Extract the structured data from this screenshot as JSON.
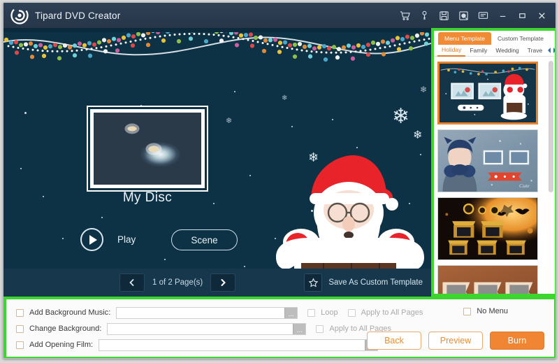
{
  "window": {
    "app_title": "Tipard DVD Creator",
    "logo_icon": "swirl-logo-icon",
    "titlebar_icons": [
      {
        "name": "cart-icon",
        "label": "Buy"
      },
      {
        "name": "key-icon",
        "label": "Register"
      },
      {
        "name": "save-icon",
        "label": "Save"
      },
      {
        "name": "help-icon",
        "label": "Help"
      },
      {
        "name": "feedback-icon",
        "label": "Feedback"
      },
      {
        "name": "minimize-icon",
        "label": "Minimize"
      },
      {
        "name": "maximize-icon",
        "label": "Maximize"
      },
      {
        "name": "close-icon",
        "label": "Close"
      }
    ]
  },
  "preview": {
    "disc_title": "My Disc",
    "play_label": "Play",
    "scene_label": "Scene",
    "page_count": "1 of 2 Page(s)",
    "prev_icon": "chevron-left-icon",
    "next_icon": "chevron-right-icon",
    "save_template_label": "Save As Custom Template",
    "save_template_icon": "star-icon",
    "background_color": "#0d3145",
    "theme": "christmas-santa-chimney"
  },
  "right_panel": {
    "tabs": [
      {
        "label": "Menu Template",
        "active": true
      },
      {
        "label": "Custom Template",
        "active": false
      }
    ],
    "sub_tabs": [
      {
        "label": "Holiday",
        "active": true
      },
      {
        "label": "Family",
        "active": false
      },
      {
        "label": "Wedding",
        "active": false
      },
      {
        "label": "Trave",
        "active": false
      }
    ],
    "sub_tab_arrows": [
      "left-arrow-icon",
      "right-arrow-icon"
    ],
    "templates": [
      {
        "name": "santa-chimney-template",
        "selected": true
      },
      {
        "name": "winter-child-template",
        "selected": false
      },
      {
        "name": "halloween-template",
        "selected": false
      },
      {
        "name": "vintage-orange-template",
        "selected": false
      }
    ],
    "accent_color": "#f08a34",
    "highlight_border_color": "#3dd62f"
  },
  "bottom": {
    "rows": [
      {
        "checkbox_label": "Add Background Music:",
        "value": "",
        "placeholder": "",
        "browse_label": "...",
        "extras": [
          {
            "label": "Loop",
            "disabled": true
          },
          {
            "label": "Apply to All Pages",
            "disabled": true
          }
        ]
      },
      {
        "checkbox_label": "Change Background:",
        "value": "",
        "placeholder": "",
        "browse_label": "...",
        "extras": [
          {
            "label": "Apply to All Pages",
            "disabled": true
          }
        ]
      },
      {
        "checkbox_label": "Add Opening Film:",
        "value": "",
        "placeholder": "",
        "browse_label": "...",
        "extras": []
      }
    ],
    "no_menu_label": "No Menu",
    "buttons": [
      {
        "label": "Back",
        "style": "ghost"
      },
      {
        "label": "Preview",
        "style": "ghost"
      },
      {
        "label": "Burn",
        "style": "primary"
      }
    ]
  }
}
